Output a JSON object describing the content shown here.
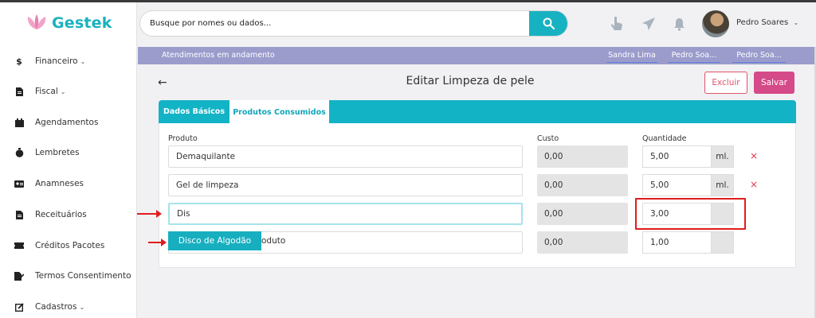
{
  "app": {
    "logo_text": "Gestek"
  },
  "sidebar": {
    "items": [
      {
        "label": "Financeiro",
        "icon": "dollar-icon",
        "has_submenu": true
      },
      {
        "label": "Fiscal",
        "icon": "document-icon",
        "has_submenu": true
      },
      {
        "label": "Agendamentos",
        "icon": "calendar-icon",
        "has_submenu": false
      },
      {
        "label": "Lembretes",
        "icon": "stopwatch-icon",
        "has_submenu": false
      },
      {
        "label": "Anamneses",
        "icon": "id-card-icon",
        "has_submenu": false
      },
      {
        "label": "Receituários",
        "icon": "document-icon",
        "has_submenu": false
      },
      {
        "label": "Créditos Pacotes",
        "icon": "ticket-icon",
        "has_submenu": false
      },
      {
        "label": "Termos Consentimento",
        "icon": "signature-icon",
        "has_submenu": false
      },
      {
        "label": "Cadastros",
        "icon": "edit-icon",
        "has_submenu": true
      }
    ]
  },
  "header": {
    "search_placeholder": "Busque por nomes ou dados...",
    "user_name": "Pedro Soares",
    "icons": [
      "hand-pointer-icon",
      "paper-plane-icon",
      "bell-icon"
    ]
  },
  "in_progress": {
    "label": "Atendimentos em andamento",
    "users": [
      "Sandra Lima",
      "Pedro Soa...",
      "Pedro Soa..."
    ]
  },
  "page": {
    "title": "Editar Limpeza de pele",
    "delete_label": "Excluir",
    "save_label": "Salvar"
  },
  "tabs": [
    {
      "label": "Dados Básicos",
      "active": false
    },
    {
      "label": "Produtos Consumidos",
      "active": true
    }
  ],
  "products_table": {
    "headers": {
      "product": "Produto",
      "cost": "Custo",
      "quantity": "Quantidade"
    },
    "rows": [
      {
        "product": "Demaquilante",
        "cost": "0,00",
        "quantity": "5,00",
        "unit": "ml.",
        "removable": true
      },
      {
        "product": "Gel de limpeza",
        "cost": "0,00",
        "quantity": "5,00",
        "unit": "ml.",
        "removable": true
      },
      {
        "product": "Dis",
        "cost": "0,00",
        "quantity": "3,00",
        "unit": "",
        "removable": false
      },
      {
        "product": "oduto",
        "cost": "0,00",
        "quantity": "1,00",
        "unit": "",
        "removable": false
      }
    ],
    "remove_symbol": "×"
  },
  "autocomplete": {
    "suggestion": "Disco de Algodão"
  },
  "colors": {
    "brand": "#1ab2bf",
    "accent": "#16b2c1",
    "progress_bar": "#9b9ccc",
    "save": "#d54a88",
    "delete": "#e1536b",
    "annotation": "#e01d1d"
  }
}
